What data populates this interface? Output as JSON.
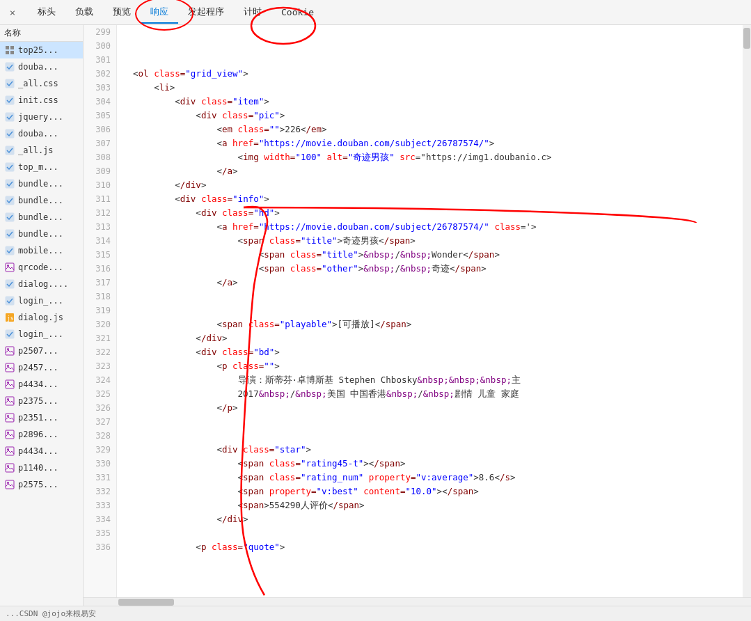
{
  "tabs": {
    "close_label": "×",
    "items": [
      {
        "id": "header",
        "label": "标头"
      },
      {
        "id": "payload",
        "label": "负载"
      },
      {
        "id": "preview",
        "label": "预览"
      },
      {
        "id": "response",
        "label": "响应",
        "active": true
      },
      {
        "id": "initiator",
        "label": "发起程序"
      },
      {
        "id": "timing",
        "label": "计时"
      },
      {
        "id": "cookie",
        "label": "Cookie"
      }
    ]
  },
  "sidebar": {
    "header": "名称",
    "items": [
      {
        "id": "top25",
        "label": "top25...",
        "icon": "grid"
      },
      {
        "id": "douba1",
        "label": "douba...",
        "icon": "check"
      },
      {
        "id": "allcss",
        "label": "_all.css",
        "icon": "check"
      },
      {
        "id": "initcss",
        "label": "init.css",
        "icon": "check"
      },
      {
        "id": "jquery",
        "label": "jquery...",
        "icon": "check"
      },
      {
        "id": "douba2",
        "label": "douba...",
        "icon": "check"
      },
      {
        "id": "alljs",
        "label": "_all.js",
        "icon": "check"
      },
      {
        "id": "topm",
        "label": "top_m...",
        "icon": "check"
      },
      {
        "id": "bundle1",
        "label": "bundle...",
        "icon": "check"
      },
      {
        "id": "bundle2",
        "label": "bundle...",
        "icon": "check"
      },
      {
        "id": "bundle3",
        "label": "bundle...",
        "icon": "check"
      },
      {
        "id": "bundle4",
        "label": "bundle...",
        "icon": "check"
      },
      {
        "id": "mobile",
        "label": "mobile...",
        "icon": "check"
      },
      {
        "id": "qrcode",
        "label": "qrcode...",
        "icon": "img"
      },
      {
        "id": "dialog1",
        "label": "dialog....",
        "icon": "check"
      },
      {
        "id": "login1",
        "label": "login_...",
        "icon": "check"
      },
      {
        "id": "dialogjs",
        "label": "dialog.js",
        "icon": "js"
      },
      {
        "id": "login2",
        "label": "login_...",
        "icon": "check"
      },
      {
        "id": "p2507",
        "label": "p2507...",
        "icon": "img"
      },
      {
        "id": "p2457",
        "label": "p2457...",
        "icon": "img"
      },
      {
        "id": "p4434a",
        "label": "p4434...",
        "icon": "img"
      },
      {
        "id": "p2375",
        "label": "p2375...",
        "icon": "img"
      },
      {
        "id": "p2351",
        "label": "p2351...",
        "icon": "img"
      },
      {
        "id": "p2896",
        "label": "p2896...",
        "icon": "img"
      },
      {
        "id": "p4434b",
        "label": "p4434...",
        "icon": "img"
      },
      {
        "id": "p1140",
        "label": "p1140...",
        "icon": "img"
      },
      {
        "id": "p2575",
        "label": "p2575...",
        "icon": "img"
      }
    ]
  },
  "code": {
    "lines": [
      {
        "num": 299,
        "content": ""
      },
      {
        "num": 300,
        "content": ""
      },
      {
        "num": 301,
        "content": ""
      },
      {
        "num": 302,
        "content": "  <ol class=\"grid_view\">"
      },
      {
        "num": 303,
        "content": "      <li>"
      },
      {
        "num": 304,
        "content": "          <div class=\"item\">"
      },
      {
        "num": 305,
        "content": "              <div class=\"pic\">"
      },
      {
        "num": 306,
        "content": "                  <em class=\"\">226</em>"
      },
      {
        "num": 307,
        "content": "                  <a href=\"https://movie.douban.com/subject/26787574/\">"
      },
      {
        "num": 308,
        "content": "                      <img width=\"100\" alt=\"奇迹男孩\" src=\"https://img1.doubanio.c"
      },
      {
        "num": 309,
        "content": "                  </a>"
      },
      {
        "num": 310,
        "content": "          </div>"
      },
      {
        "num": 311,
        "content": "          <div class=\"info\">"
      },
      {
        "num": 312,
        "content": "              <div class=\"hd\">"
      },
      {
        "num": 313,
        "content": "                  <a href=\"https://movie.douban.com/subject/26787574/\" class='"
      },
      {
        "num": 314,
        "content": "                      <span class=\"title\">奇迹男孩</span>"
      },
      {
        "num": 315,
        "content": "                          <span class=\"title\">&nbsp;/&nbsp;Wonder</span>"
      },
      {
        "num": 316,
        "content": "                          <span class=\"other\">&nbsp;/&nbsp;奇迹</span>"
      },
      {
        "num": 317,
        "content": "                  </a>"
      },
      {
        "num": 318,
        "content": ""
      },
      {
        "num": 319,
        "content": ""
      },
      {
        "num": 320,
        "content": "                  <span class=\"playable\">[可播放]</span>"
      },
      {
        "num": 321,
        "content": "              </div>"
      },
      {
        "num": 322,
        "content": "              <div class=\"bd\">"
      },
      {
        "num": 323,
        "content": "                  <p class=\"\">"
      },
      {
        "num": 324,
        "content": "                      导演：斯蒂芬·卓博斯基 Stephen Chbosky&nbsp;&nbsp;&nbsp;主"
      },
      {
        "num": 325,
        "content": "                      2017&nbsp;/&nbsp;美国 中国香港&nbsp;/&nbsp;剧情 儿童 家庭"
      },
      {
        "num": 326,
        "content": "                  </p>"
      },
      {
        "num": 327,
        "content": ""
      },
      {
        "num": 328,
        "content": ""
      },
      {
        "num": 329,
        "content": "                  <div class=\"star\">"
      },
      {
        "num": 330,
        "content": "                      <span class=\"rating45-t\"></span>"
      },
      {
        "num": 331,
        "content": "                      <span class=\"rating_num\" property=\"v:average\">8.6</s"
      },
      {
        "num": 332,
        "content": "                      <span property=\"v:best\" content=\"10.0\"></span>"
      },
      {
        "num": 333,
        "content": "                      <span>554290人评价</span>"
      },
      {
        "num": 334,
        "content": "                  </div>"
      },
      {
        "num": 335,
        "content": ""
      },
      {
        "num": 336,
        "content": "              <p class=\"quote\">"
      }
    ]
  },
  "status_bar": {
    "text": "...CSDN @jojo来根易安"
  }
}
